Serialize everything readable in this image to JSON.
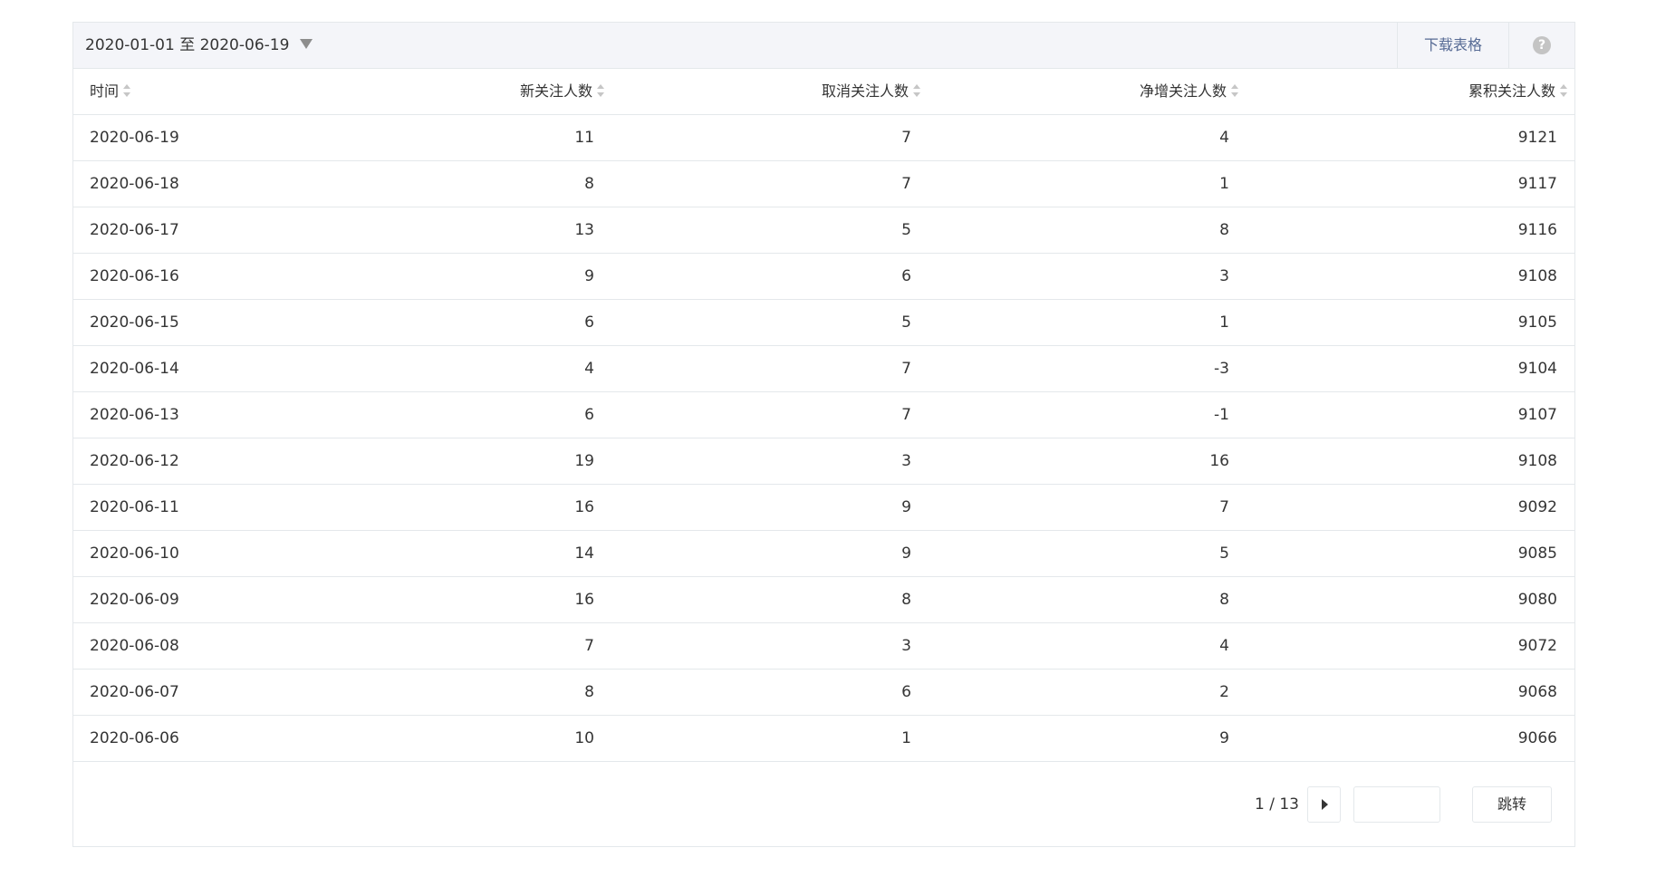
{
  "toolbar": {
    "date_range": "2020-01-01 至 2020-06-19",
    "download_label": "下载表格",
    "help_glyph": "?"
  },
  "table": {
    "columns": [
      "时间",
      "新关注人数",
      "取消关注人数",
      "净增关注人数",
      "累积关注人数"
    ],
    "rows": [
      [
        "2020-06-19",
        "11",
        "7",
        "4",
        "9121"
      ],
      [
        "2020-06-18",
        "8",
        "7",
        "1",
        "9117"
      ],
      [
        "2020-06-17",
        "13",
        "5",
        "8",
        "9116"
      ],
      [
        "2020-06-16",
        "9",
        "6",
        "3",
        "9108"
      ],
      [
        "2020-06-15",
        "6",
        "5",
        "1",
        "9105"
      ],
      [
        "2020-06-14",
        "4",
        "7",
        "-3",
        "9104"
      ],
      [
        "2020-06-13",
        "6",
        "7",
        "-1",
        "9107"
      ],
      [
        "2020-06-12",
        "19",
        "3",
        "16",
        "9108"
      ],
      [
        "2020-06-11",
        "16",
        "9",
        "7",
        "9092"
      ],
      [
        "2020-06-10",
        "14",
        "9",
        "5",
        "9085"
      ],
      [
        "2020-06-09",
        "16",
        "8",
        "8",
        "9080"
      ],
      [
        "2020-06-08",
        "7",
        "3",
        "4",
        "9072"
      ],
      [
        "2020-06-07",
        "8",
        "6",
        "2",
        "9068"
      ],
      [
        "2020-06-06",
        "10",
        "1",
        "9",
        "9066"
      ]
    ]
  },
  "pagination": {
    "page_text": "1 / 13",
    "jump_input_value": "",
    "jump_label": "跳转"
  },
  "colors": {
    "accent_link": "#576b95",
    "header_bg": "#f4f5f9",
    "border": "#e4e8eb",
    "text": "#353535"
  }
}
